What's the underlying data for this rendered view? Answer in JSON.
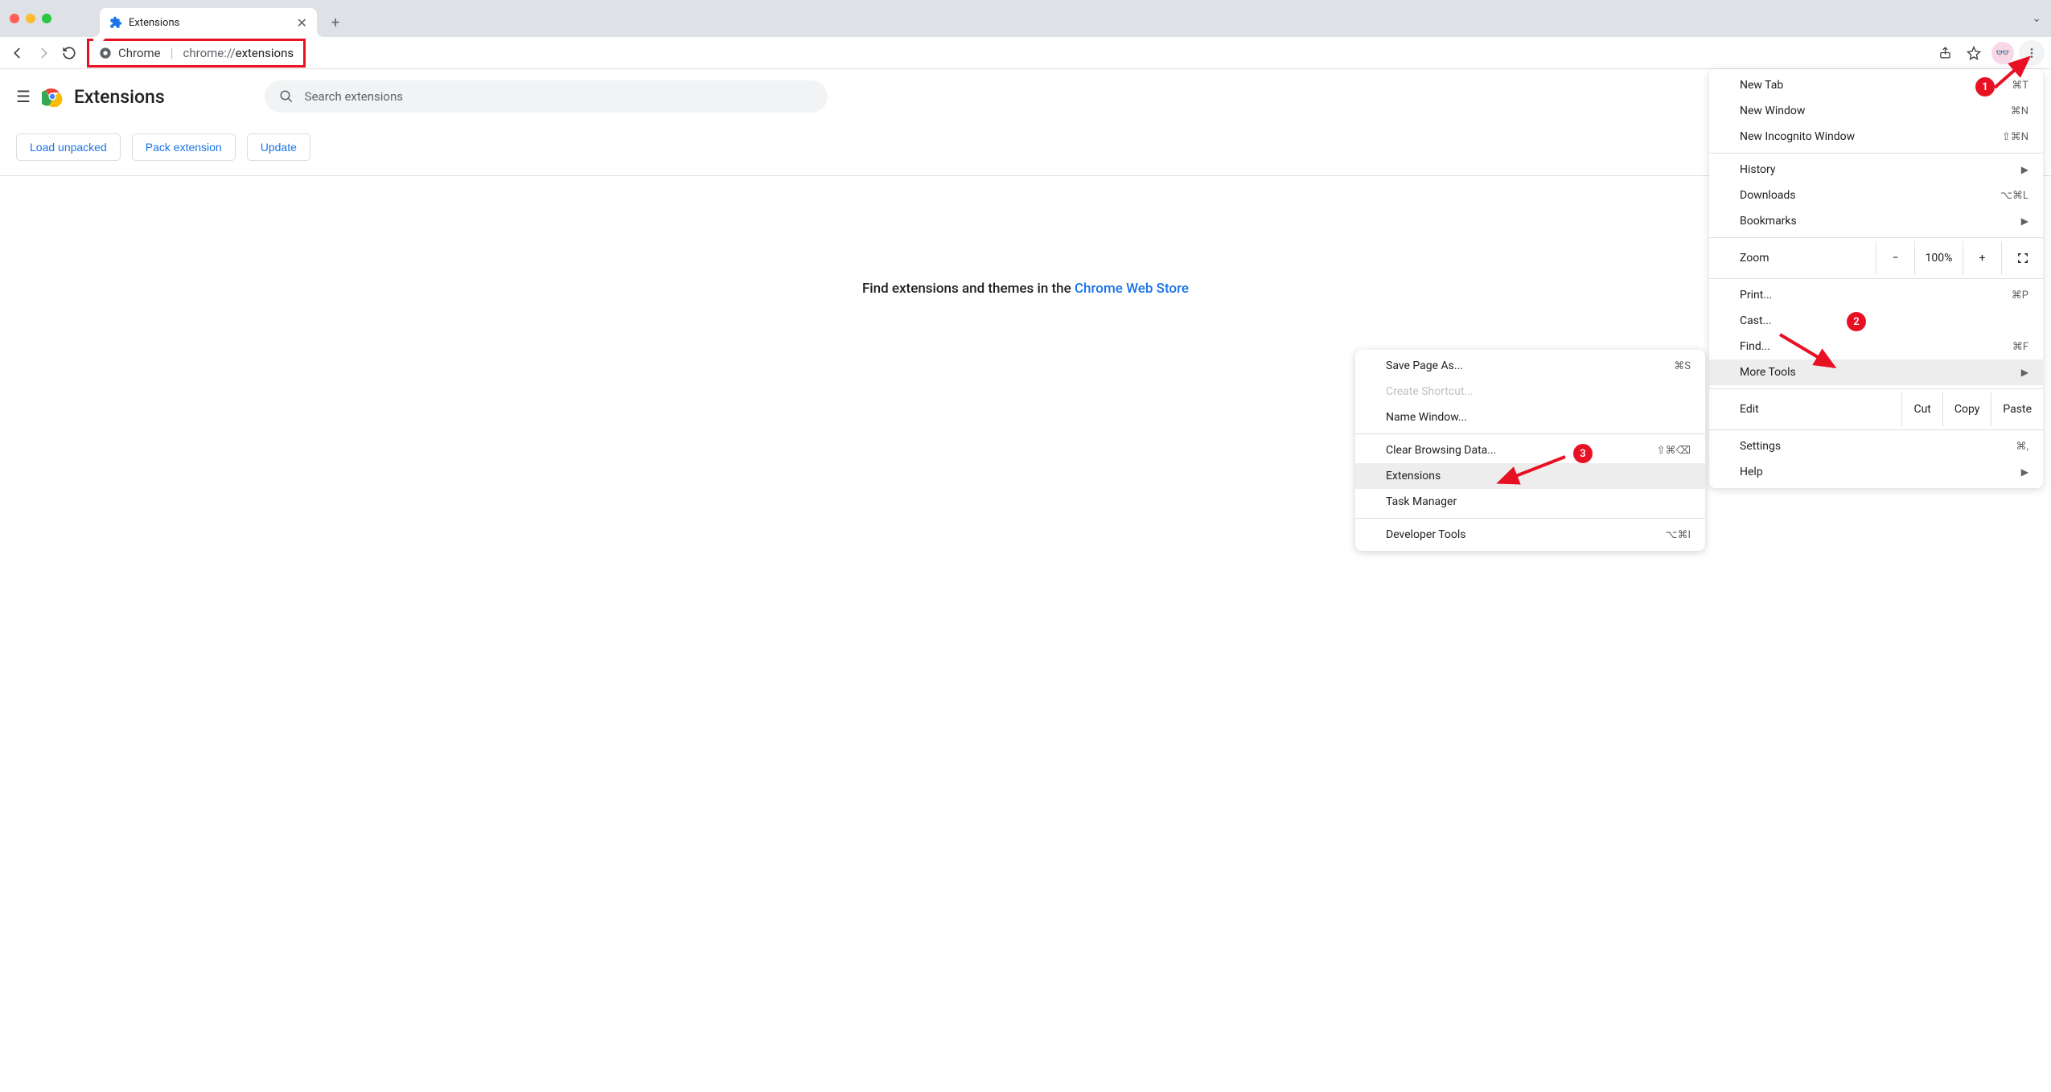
{
  "window": {
    "tab_title": "Extensions",
    "chevron": "⌄"
  },
  "toolbar": {
    "omnibox_badge": "Chrome",
    "url_prefix": "chrome://",
    "url_path": "extensions"
  },
  "page": {
    "title": "Extensions",
    "search_placeholder": "Search extensions",
    "buttons": {
      "load": "Load unpacked",
      "pack": "Pack extension",
      "update": "Update"
    },
    "find_prefix": "Find extensions and themes in the ",
    "find_link": "Chrome Web Store"
  },
  "menu": {
    "new_tab": "New Tab",
    "new_tab_sc": "⌘T",
    "new_window": "New Window",
    "new_window_sc": "⌘N",
    "new_incognito": "New Incognito Window",
    "new_incognito_sc": "⇧⌘N",
    "history": "History",
    "downloads": "Downloads",
    "downloads_sc": "⌥⌘L",
    "bookmarks": "Bookmarks",
    "zoom": "Zoom",
    "zoom_value": "100%",
    "print": "Print...",
    "print_sc": "⌘P",
    "cast": "Cast...",
    "find": "Find...",
    "find_sc": "⌘F",
    "more_tools": "More Tools",
    "edit": "Edit",
    "cut": "Cut",
    "copy": "Copy",
    "paste": "Paste",
    "settings": "Settings",
    "settings_sc": "⌘,",
    "help": "Help"
  },
  "submenu": {
    "save_as": "Save Page As...",
    "save_as_sc": "⌘S",
    "create_shortcut": "Create Shortcut...",
    "name_window": "Name Window...",
    "clear_browsing": "Clear Browsing Data...",
    "clear_browsing_sc": "⇧⌘⌫",
    "extensions": "Extensions",
    "task_manager": "Task Manager",
    "developer_tools": "Developer Tools",
    "devtools_sc": "⌥⌘I"
  },
  "annotation": {
    "one": "1",
    "two": "2",
    "three": "3",
    "color": "#e81123"
  }
}
